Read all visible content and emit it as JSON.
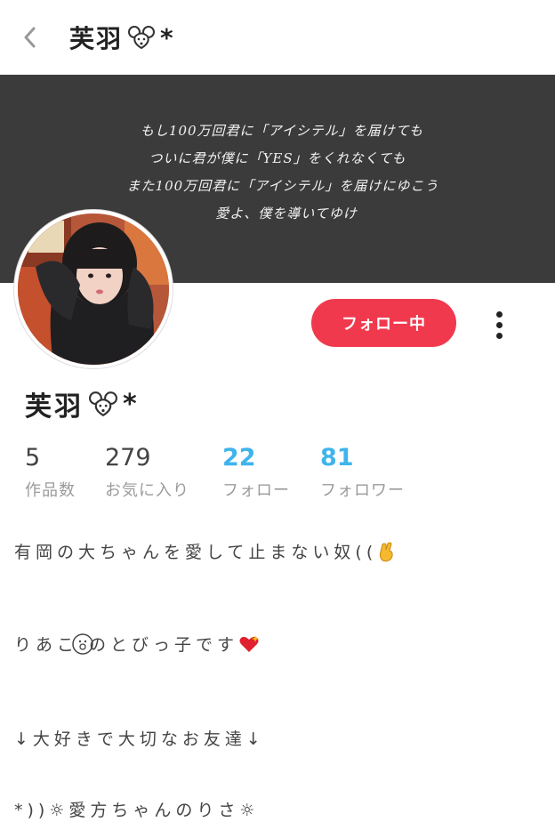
{
  "header": {
    "title": "芙羽",
    "title_suffix": "*"
  },
  "banner": {
    "lines": [
      "もし100万回君に「アイシテル」を届けても",
      "ついに君が僕に「YES」をくれなくても",
      "また100万回君に「アイシテル」を届けにゆこう",
      "愛よ、僕を導いてゆけ"
    ]
  },
  "actions": {
    "follow_label": "フォロー中"
  },
  "profile": {
    "name": "芙羽",
    "name_suffix": "*"
  },
  "stats": [
    {
      "value": "5",
      "label": "作品数"
    },
    {
      "value": "279",
      "label": "お気に入り"
    },
    {
      "value": "22",
      "label": "フォロー"
    },
    {
      "value": "81",
      "label": "フォロワー"
    }
  ],
  "bio": {
    "line1": "有岡の大ちゃんを愛して止まない奴((",
    "line2_a": "りあこ",
    "line2_b": "のとびっ子です",
    "line3": "↓大好きで大切なお友達↓",
    "line4": "*))☼愛方ちゃんのりさ☼"
  },
  "colors": {
    "accent_pink": "#f1394e",
    "link_blue": "#3fb4ec",
    "banner_bg": "#3b3b3b"
  },
  "icons": {
    "back": "chevron-left-icon",
    "mouse": "mouse-face-icon",
    "more": "vertical-dots-icon"
  }
}
